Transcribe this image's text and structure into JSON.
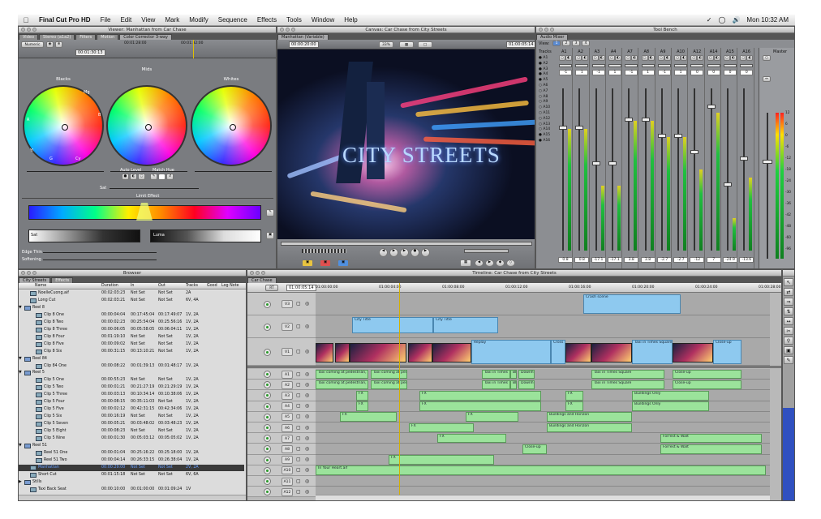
{
  "menubar": {
    "app": "Final Cut Pro HD",
    "items": [
      "File",
      "Edit",
      "View",
      "Mark",
      "Modify",
      "Sequence",
      "Effects",
      "Tools",
      "Window",
      "Help"
    ],
    "clock": "Mon 10:32 AM"
  },
  "viewer": {
    "title": "Viewer: Manhattan from Car Chase",
    "tabs": [
      "Video",
      "Stereo (a1a2)",
      "Filters",
      "Motion",
      "Color Corrector 3-way"
    ],
    "numeric": "Numeric",
    "tc_left": "00:01:30:13",
    "tc_ruler": [
      "00:01:28:00",
      "00:01:32:00"
    ],
    "wheels": [
      "Blacks",
      "Mids",
      "Whites"
    ],
    "hue_labels": [
      "R",
      "Mg",
      "B",
      "Cy",
      "G",
      "Yl"
    ],
    "auto_level": "Auto Level",
    "match_hue": "Match Hue",
    "sat": "Sat",
    "limit_effect": "Limit Effect",
    "sat_label": "Sat",
    "luma_label": "Luma",
    "edge_thin": "Edge Thin",
    "softening": "Softening"
  },
  "canvas": {
    "title": "Canvas: Car Chase from City Streets",
    "tab": "Manhattan (Variable)",
    "tc_left": "00:00:20:00",
    "zoom": "33%",
    "tc_right": "01:00:05:14",
    "overlay": "CITY STREETS"
  },
  "toolbench": {
    "title": "Tool Bench",
    "tab": "Audio Mixer",
    "view": "View:",
    "view_buttons": [
      "1",
      "2",
      "3",
      "4"
    ],
    "tracks_label": "Tracks",
    "tracks": [
      "A1",
      "A2",
      "A3",
      "A4",
      "A5",
      "A6",
      "A7",
      "A8",
      "A9",
      "A10",
      "A11",
      "A12",
      "A13",
      "A14",
      "A15",
      "A16"
    ],
    "channels": [
      "A1",
      "A2",
      "A3",
      "A4",
      "A7",
      "A8",
      "A9",
      "A10",
      "A12",
      "A14",
      "A15",
      "A16"
    ],
    "pans": [
      "-1",
      "1",
      "-1",
      "1",
      "-1",
      "1",
      "-1",
      "1",
      "0",
      "0",
      "0",
      "0"
    ],
    "levels": [
      "0.8",
      "0.8",
      "-17.1",
      "-17.1",
      "3.8",
      "3.8",
      "-2.7",
      "-2.7",
      "-12",
      "7",
      "-24.9",
      "-13.6"
    ],
    "master": "Master",
    "db": [
      "12",
      "6",
      "0",
      "-6",
      "-12",
      "-18",
      "-24",
      "-30",
      "-36",
      "-42",
      "-48",
      "-60",
      "-96"
    ]
  },
  "browser": {
    "title": "Browser",
    "tabs": [
      "City Streets",
      "Effects"
    ],
    "columns": [
      "Name",
      "Duration",
      "In",
      "Out",
      "Tracks",
      "Good",
      "Log Note"
    ],
    "rows": [
      {
        "name": "NoelleCuong.aif",
        "dur": "00:02:03:23",
        "in": "Not Set",
        "out": "Not Set",
        "tracks": "2A",
        "level": 1,
        "kind": "clip"
      },
      {
        "name": "Long Cut",
        "dur": "00:02:03:21",
        "in": "Not Set",
        "out": "Not Set",
        "tracks": "6V, 4A",
        "level": 1,
        "kind": "clip"
      },
      {
        "name": "Reel 8",
        "dur": "",
        "in": "",
        "out": "",
        "tracks": "",
        "level": 0,
        "kind": "bin"
      },
      {
        "name": "Clip 8 One",
        "dur": "00:00:04:04",
        "in": "00:17:45:04",
        "out": "00:17:49:07",
        "tracks": "1V, 2A",
        "level": 2,
        "kind": "clip"
      },
      {
        "name": "Clip 8 Two",
        "dur": "00:00:02:23",
        "in": "00:25:54:04",
        "out": "00:25:56:16",
        "tracks": "1V, 2A",
        "level": 2,
        "kind": "clip"
      },
      {
        "name": "Clip 8 Three",
        "dur": "00:00:06:05",
        "in": "00:05:58:05",
        "out": "00:06:04:11",
        "tracks": "1V, 2A",
        "level": 2,
        "kind": "clip"
      },
      {
        "name": "Clip 8 Four",
        "dur": "00:01:19:10",
        "in": "Not Set",
        "out": "Not Set",
        "tracks": "1V, 2A",
        "level": 2,
        "kind": "clip"
      },
      {
        "name": "Clip 8 Five",
        "dur": "00:00:09:02",
        "in": "Not Set",
        "out": "Not Set",
        "tracks": "1V, 2A",
        "level": 2,
        "kind": "clip"
      },
      {
        "name": "Clip 8 Six",
        "dur": "00:00:31:15",
        "in": "00:13:10:21",
        "out": "Not Set",
        "tracks": "1V, 2A",
        "level": 2,
        "kind": "clip"
      },
      {
        "name": "Reel 84",
        "dur": "",
        "in": "",
        "out": "",
        "tracks": "",
        "level": 0,
        "kind": "bin"
      },
      {
        "name": "Clip 84 One",
        "dur": "00:00:08:22",
        "in": "00:01:39:13",
        "out": "00:01:48:17",
        "tracks": "1V, 2A",
        "level": 2,
        "kind": "clip"
      },
      {
        "name": "Reel 5",
        "dur": "",
        "in": "",
        "out": "",
        "tracks": "",
        "level": 0,
        "kind": "bin"
      },
      {
        "name": "Clip 5 One",
        "dur": "00:00:55:23",
        "in": "Not Set",
        "out": "Not Set",
        "tracks": "1V, 2A",
        "level": 2,
        "kind": "clip"
      },
      {
        "name": "Clip 5 Two",
        "dur": "00:00:01:21",
        "in": "00:21:27:19",
        "out": "00:21:29:19",
        "tracks": "1V, 2A",
        "level": 2,
        "kind": "clip"
      },
      {
        "name": "Clip 5 Three",
        "dur": "00:00:03:13",
        "in": "00:10:34:14",
        "out": "00:10:38:06",
        "tracks": "1V, 2A",
        "level": 2,
        "kind": "clip"
      },
      {
        "name": "Clip 5 Four",
        "dur": "00:00:08:15",
        "in": "00:35:11:03",
        "out": "Not Set",
        "tracks": "1V, 2A",
        "level": 2,
        "kind": "clip"
      },
      {
        "name": "Clip 5 Five",
        "dur": "00:00:02:12",
        "in": "00:42:31:15",
        "out": "00:42:34:06",
        "tracks": "1V, 2A",
        "level": 2,
        "kind": "clip"
      },
      {
        "name": "Clip 5 Six",
        "dur": "00:00:16:19",
        "in": "Not Set",
        "out": "Not Set",
        "tracks": "1V, 2A",
        "level": 2,
        "kind": "clip"
      },
      {
        "name": "Clip 5 Seven",
        "dur": "00:00:05:21",
        "in": "00:03:48:02",
        "out": "00:03:48:23",
        "tracks": "1V, 2A",
        "level": 2,
        "kind": "clip"
      },
      {
        "name": "Clip 5 Eight",
        "dur": "00:00:08:23",
        "in": "Not Set",
        "out": "Not Set",
        "tracks": "1V, 2A",
        "level": 2,
        "kind": "clip"
      },
      {
        "name": "Clip 5 Nine",
        "dur": "00:00:01:30",
        "in": "00:05:03:12",
        "out": "00:05:05:02",
        "tracks": "1V, 2A",
        "level": 2,
        "kind": "clip"
      },
      {
        "name": "Reel 51",
        "dur": "",
        "in": "",
        "out": "",
        "tracks": "",
        "level": 0,
        "kind": "bin"
      },
      {
        "name": "Reel 51 One",
        "dur": "00:00:01:04",
        "in": "00:25:16:22",
        "out": "00:25:18:00",
        "tracks": "1V, 2A",
        "level": 2,
        "kind": "clip"
      },
      {
        "name": "Reel 51 Two",
        "dur": "00:00:04:14",
        "in": "00:26:33:15",
        "out": "00:26:38:04",
        "tracks": "1V, 2A",
        "level": 2,
        "kind": "clip"
      },
      {
        "name": "Manhattan",
        "dur": "00:00:29:00",
        "in": "Not Set",
        "out": "Not Set",
        "tracks": "2V, 2A",
        "level": 1,
        "kind": "clip",
        "selected": true
      },
      {
        "name": "Short Cut",
        "dur": "00:01:15:18",
        "in": "Not Set",
        "out": "Not Set",
        "tracks": "6V, 6A",
        "level": 1,
        "kind": "clip"
      },
      {
        "name": "Stills",
        "dur": "",
        "in": "",
        "out": "",
        "tracks": "",
        "level": 0,
        "kind": "bin",
        "collapsed": true
      },
      {
        "name": "Taxi Back Seat",
        "dur": "00:00:10:00",
        "in": "00:01:00:00",
        "out": "00:01:09:24",
        "tracks": "1V",
        "level": 1,
        "kind": "clip"
      }
    ]
  },
  "timeline": {
    "title": "Timeline: Car Chase from City Streets",
    "tab": "Car Chase",
    "rt": "RT",
    "tc": "01:00:05:14",
    "ruler": [
      "01:00:00:00",
      "01:00:04:00",
      "01:00:08:00",
      "01:00:12:00",
      "01:00:16:00",
      "01:00:20:00",
      "01:00:24:00",
      "01:00:28:00"
    ],
    "vtracks": [
      "V3",
      "V2",
      "V1"
    ],
    "atracks": [
      "A1",
      "A2",
      "A3",
      "A4",
      "A5",
      "A6",
      "A7",
      "A8",
      "A9",
      "A10",
      "A11",
      "A12"
    ],
    "clips_v": [
      "Crash scene",
      "City Title",
      "City Title",
      "Replay",
      "Cross",
      "Taxi in Times Square",
      "Close-up"
    ],
    "clips_a": [
      "Taxi coming at pedestrian, w",
      "Taxi coming at pedes",
      "Taxi in Times",
      "Blk",
      "Downhil",
      "Taxi in Times Square",
      "Close-up",
      "Taxi coming at pedestrian, w",
      "Taxi coming at pedes",
      "Taxi in Times",
      "Blk",
      "Downhil",
      "Taxi in Times Square",
      "Close-up",
      "FX",
      "Buildings Only",
      "Buildings and Horizon",
      "Forrest & Walt",
      "Close-up",
      "In Your Heart.aif"
    ]
  },
  "colors": {
    "window": "#7a7c80",
    "videoclip": "#8ec9ef",
    "audioclip": "#9be39b",
    "accent": "#2a9a2a"
  }
}
